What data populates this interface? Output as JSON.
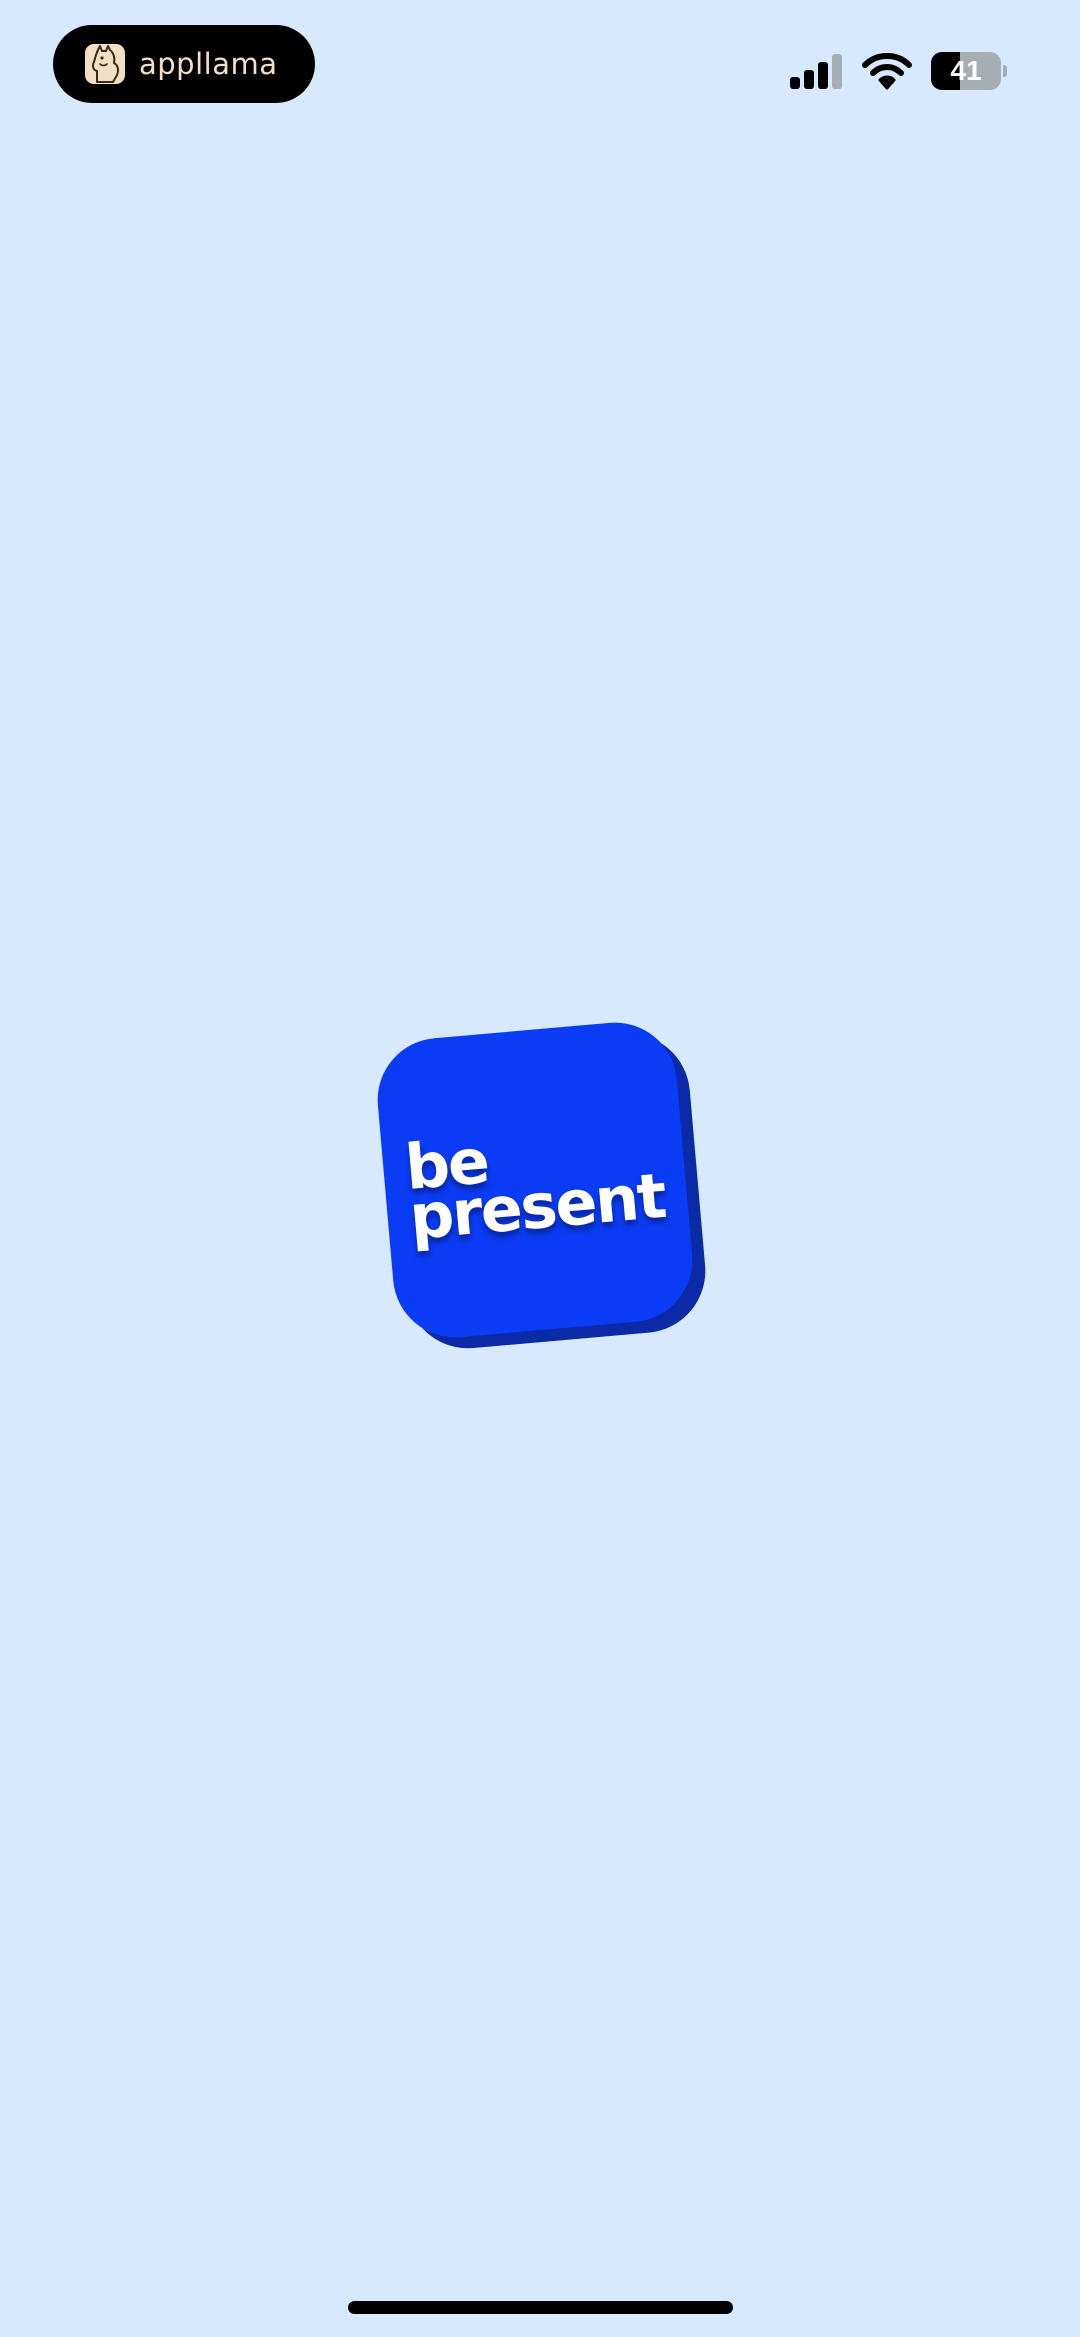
{
  "screen": {
    "background_color": "#d6e9ff"
  },
  "status_bar": {
    "island_app_label": "appllama",
    "island_logo_icon": "llama-icon",
    "signal_icon": "cellular-signal-icon",
    "signal_bars_active": 3,
    "signal_bars_total": 4,
    "wifi_icon": "wifi-icon",
    "battery_icon": "battery-icon",
    "battery_level": "41",
    "battery_fraction": 0.41
  },
  "app_logo": {
    "line_1": "be",
    "line_2": "present",
    "face_color": "#0b3cf5",
    "shadow_color": "#0a2aa6"
  },
  "home_indicator": {
    "icon": "home-indicator-bar"
  }
}
